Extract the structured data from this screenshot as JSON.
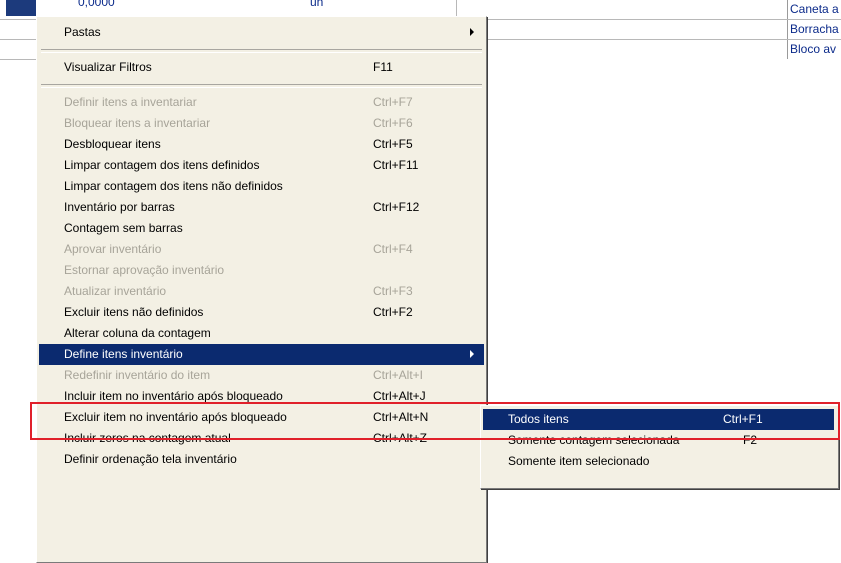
{
  "background_table": {
    "top_value": "0,0000",
    "top_unit": "un",
    "rows": [
      "Caneta a",
      "Borracha",
      "Bloco av"
    ]
  },
  "main_menu": {
    "items": [
      {
        "label": "Pastas",
        "shortcut": "",
        "submenu": true,
        "disabled": false
      },
      {
        "separator": true
      },
      {
        "label": "Visualizar Filtros",
        "shortcut": "F11",
        "disabled": false
      },
      {
        "separator": true
      },
      {
        "label": "Definir itens a inventariar",
        "shortcut": "Ctrl+F7",
        "disabled": true
      },
      {
        "label": "Bloquear itens a inventariar",
        "shortcut": "Ctrl+F6",
        "disabled": true
      },
      {
        "label": "Desbloquear itens",
        "shortcut": "Ctrl+F5",
        "disabled": false
      },
      {
        "label": "Limpar contagem dos itens definidos",
        "shortcut": "Ctrl+F11",
        "disabled": false
      },
      {
        "label": "Limpar contagem dos itens não definidos",
        "shortcut": "",
        "disabled": false
      },
      {
        "label": "Inventário por barras",
        "shortcut": "Ctrl+F12",
        "disabled": false
      },
      {
        "label": "Contagem sem barras",
        "shortcut": "",
        "disabled": false
      },
      {
        "label": "Aprovar inventário",
        "shortcut": "Ctrl+F4",
        "disabled": true
      },
      {
        "label": "Estornar aprovação inventário",
        "shortcut": "",
        "disabled": true
      },
      {
        "label": "Atualizar inventário",
        "shortcut": "Ctrl+F3",
        "disabled": true
      },
      {
        "label": "Excluir itens não definidos",
        "shortcut": "Ctrl+F2",
        "disabled": false
      },
      {
        "label": "Alterar coluna da contagem",
        "shortcut": "",
        "disabled": false
      },
      {
        "label": "Define itens inventário",
        "shortcut": "",
        "submenu": true,
        "highlighted": true,
        "disabled": false
      },
      {
        "label": "Redefinir inventário do item",
        "shortcut": "Ctrl+Alt+I",
        "disabled": true
      },
      {
        "label": "Incluir item no inventário após bloqueado",
        "shortcut": "Ctrl+Alt+J",
        "disabled": false
      },
      {
        "label": "Excluir item no inventário após bloqueado",
        "shortcut": "Ctrl+Alt+N",
        "disabled": false
      },
      {
        "label": "Incluir zeros na contagem atual",
        "shortcut": "Ctrl+Alt+Z",
        "disabled": false
      },
      {
        "label": "Definir ordenação tela inventário",
        "shortcut": "",
        "disabled": false
      }
    ]
  },
  "sub_menu": {
    "items": [
      {
        "label": "Todos itens",
        "shortcut": "Ctrl+F1",
        "highlighted": true
      },
      {
        "label": "Somente contagem selecionada",
        "shortcut": "F2",
        "highlighted": false
      },
      {
        "label": "Somente item selecionado",
        "shortcut": "",
        "highlighted": false
      }
    ]
  },
  "colors": {
    "menu_bg": "#f3f0e4",
    "highlight_bg": "#0b2a6f",
    "disabled_text": "#a7a499",
    "annotation_red": "#e0202a",
    "grid_text": "#0b2a8a"
  }
}
